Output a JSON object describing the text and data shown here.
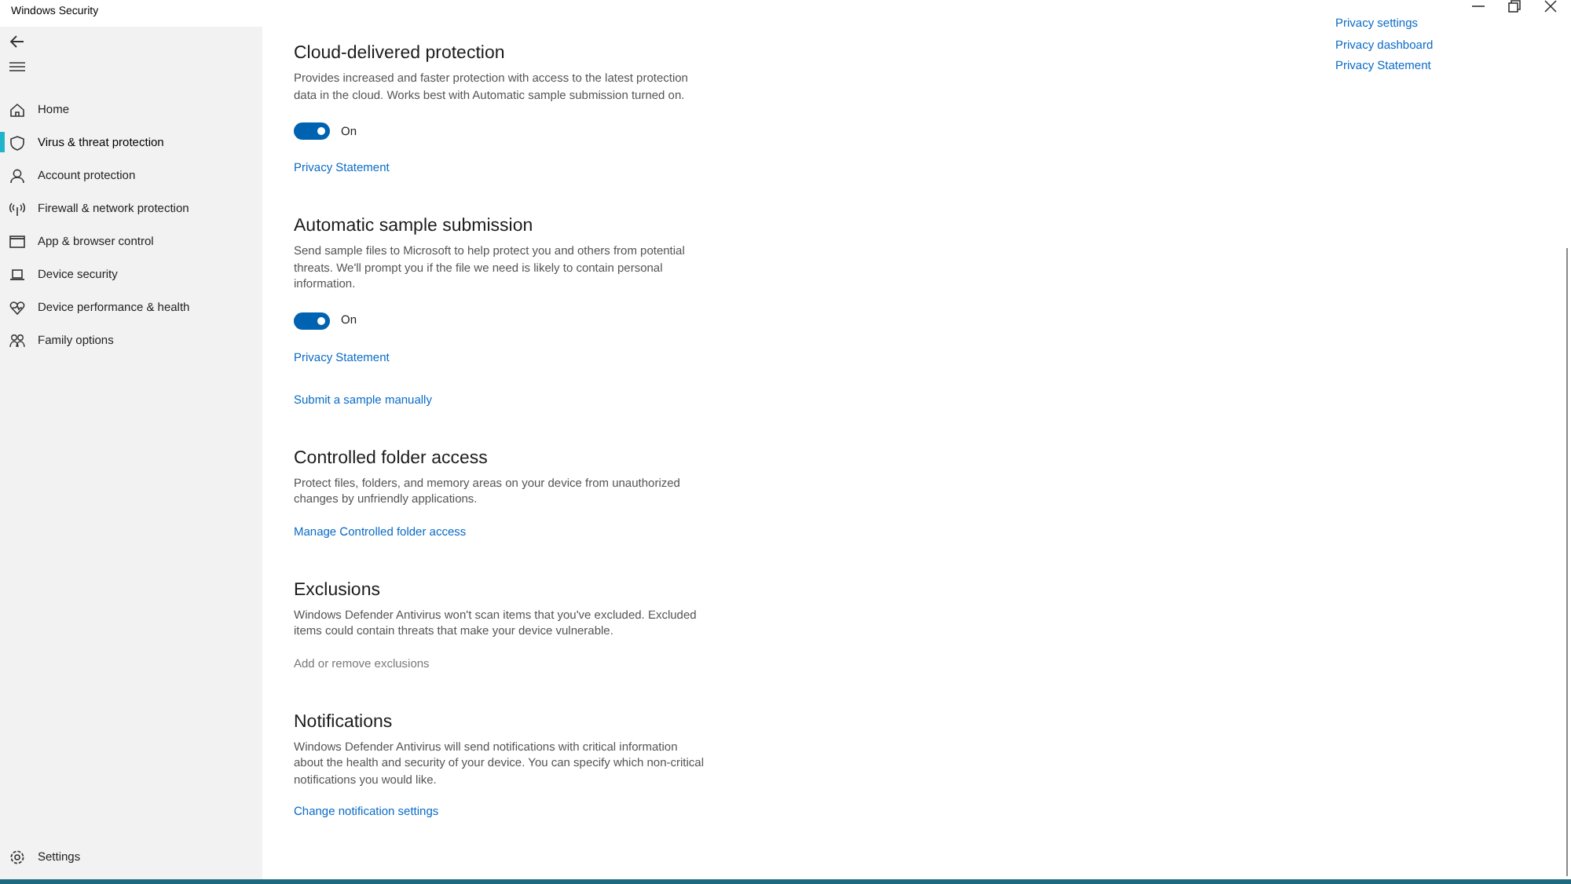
{
  "window": {
    "title": "Windows Security"
  },
  "nav": [
    {
      "kind": "home",
      "label": "Home",
      "selected": false
    },
    {
      "kind": "shield",
      "label": "Virus & threat protection",
      "selected": true
    },
    {
      "kind": "person",
      "label": "Account protection",
      "selected": false
    },
    {
      "kind": "wifi",
      "label": "Firewall & network protection",
      "selected": false
    },
    {
      "kind": "window",
      "label": "App & browser control",
      "selected": false
    },
    {
      "kind": "laptop",
      "label": "Device security",
      "selected": false
    },
    {
      "kind": "heart",
      "label": "Device performance & health",
      "selected": false
    },
    {
      "kind": "family",
      "label": "Family options",
      "selected": false
    }
  ],
  "settings_item": {
    "label": "Settings"
  },
  "sections": [
    {
      "title": "Cloud-delivered protection",
      "description": "Provides increased and faster protection with access to the latest protection data in the cloud.  Works best with Automatic sample submission turned on.",
      "toggle": {
        "on": true,
        "label": "On"
      },
      "links": [
        {
          "label": "Privacy Statement",
          "disabled": false
        }
      ]
    },
    {
      "title": "Automatic sample submission",
      "description": "Send sample files to Microsoft to help protect you and others from potential threats.  We'll prompt you if the file we need is likely to contain personal information.",
      "toggle": {
        "on": true,
        "label": "On"
      },
      "links": [
        {
          "label": "Privacy Statement",
          "disabled": false
        },
        {
          "label": "Submit a sample manually",
          "disabled": false
        }
      ]
    },
    {
      "title": "Controlled folder access",
      "description": "Protect files, folders, and memory areas on your device from unauthorized changes by unfriendly applications.",
      "links": [
        {
          "label": "Manage Controlled folder access",
          "disabled": false
        }
      ]
    },
    {
      "title": "Exclusions",
      "description": "Windows Defender Antivirus won't scan items that you've excluded. Excluded items could contain threats that make your device vulnerable.",
      "links": [
        {
          "label": "Add or remove exclusions",
          "disabled": true
        }
      ]
    },
    {
      "title": "Notifications",
      "description": "Windows Defender Antivirus will send notifications with critical information about the health and security of your device.  You can specify which non-critical notifications you would like.",
      "links": [
        {
          "label": "Change notification settings",
          "disabled": false
        }
      ]
    }
  ],
  "side_links": [
    "Privacy settings",
    "Privacy dashboard",
    "Privacy Statement"
  ]
}
